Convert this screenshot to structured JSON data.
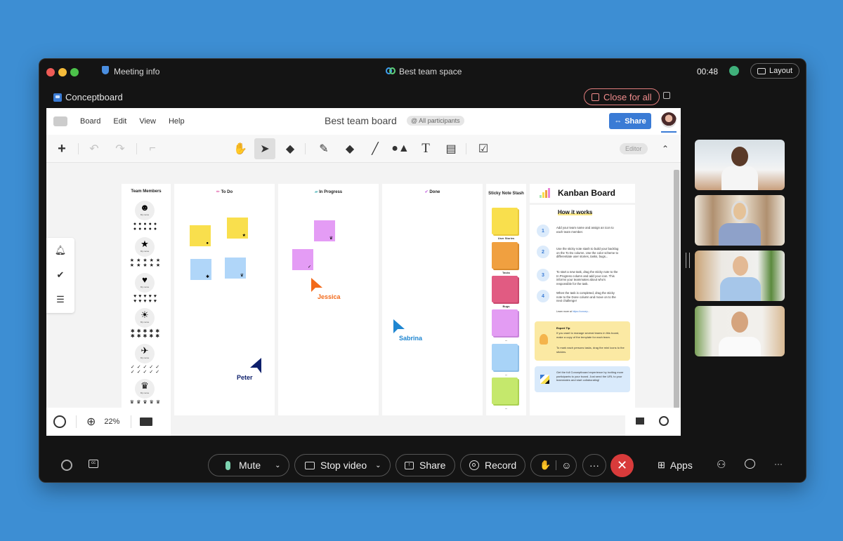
{
  "window": {
    "meeting_info": "Meeting info",
    "space_title": "Best team space",
    "timer": "00:48",
    "layout_label": "Layout"
  },
  "app": {
    "name": "Conceptboard",
    "close_for_all": "Close for all"
  },
  "board": {
    "menu": [
      "Board",
      "Edit",
      "View",
      "Help"
    ],
    "title": "Best team board",
    "mention": "@ All participants",
    "share_label": "Share",
    "mode_badge": "Editor",
    "zoom_level": "22%"
  },
  "kanban": {
    "team_members_header": "Team Members",
    "member_label": "My name",
    "members_icons": [
      "smiley",
      "star",
      "heart",
      "sun",
      "rocket",
      "crown"
    ],
    "columns": [
      {
        "title": "To Do"
      },
      {
        "title": "In Progress"
      },
      {
        "title": "Done"
      }
    ],
    "stash_header": "Sticky Note Stash",
    "stash": [
      {
        "label": "User Stories",
        "color": "#f9df4d"
      },
      {
        "label": "Tasks",
        "color": "#f0a040"
      },
      {
        "label": "Bugs",
        "color": "#e15b82"
      },
      {
        "label": "...",
        "color": "#e39cf3"
      },
      {
        "label": "...",
        "color": "#a8d3f7"
      },
      {
        "label": "...",
        "color": "#c5e86c"
      }
    ],
    "board_title": "Kanban Board",
    "how_title": "How it works",
    "steps": [
      {
        "n": "1",
        "text": "Add your team name and assign an icon to each team member."
      },
      {
        "n": "2",
        "text": "Use the sticky note stash to build your backlog on the To Do column. Use the color scheme to differentiate user stories, tasks, bugs..."
      },
      {
        "n": "3",
        "text": "To start a new task, drag the sticky note to the In Progress column and add your icon. This informs your teammates about who's responsible for the task."
      },
      {
        "n": "4",
        "text": "When the task is completed, drag the sticky note to the Done column and move on to the next challenge!"
      }
    ],
    "learn_more": "Learn more at",
    "learn_link": "https://concep...",
    "tip_title": "Expert Tip",
    "tip_text1": "If you want to manage several teams in this board, make a copy of the template for each team.",
    "tip_text2": "To mark each persons tasks, drag the mini icons to the stickies.",
    "promo_text": "Get the full Conceptboard experience by inviting more participants to your board. Just send the URL to your teammates and start collaborating!"
  },
  "cursors": [
    {
      "name": "Jessica",
      "color": "#f26a1b"
    },
    {
      "name": "Sabrina",
      "color": "#1f86d1"
    },
    {
      "name": "Peter",
      "color": "#0d1f6b"
    }
  ],
  "controls": {
    "mute": "Mute",
    "stop_video": "Stop video",
    "share": "Share",
    "record": "Record",
    "apps": "Apps"
  }
}
